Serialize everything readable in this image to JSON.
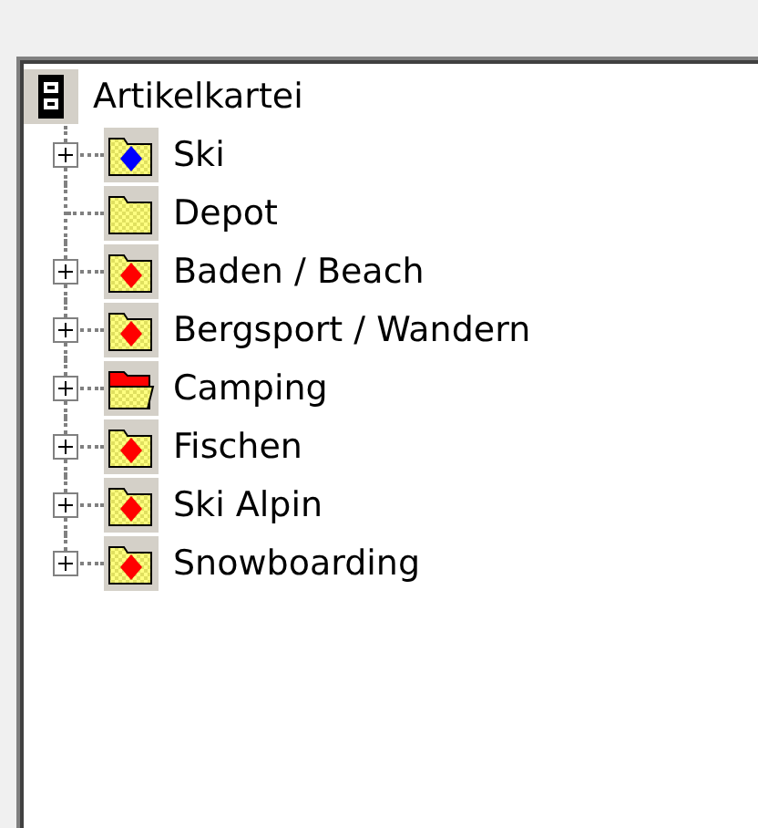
{
  "tree": {
    "root": {
      "label": "Artikelkartei"
    },
    "items": [
      {
        "label": "Ski",
        "expandable": true,
        "expanded": false,
        "icon": {
          "kind": "diamond",
          "color": "#0000ff"
        }
      },
      {
        "label": "Depot",
        "expandable": false,
        "icon": {
          "kind": "plain"
        }
      },
      {
        "label": "Baden / Beach",
        "expandable": true,
        "expanded": false,
        "icon": {
          "kind": "diamond",
          "color": "#ff0000"
        }
      },
      {
        "label": "Bergsport / Wandern",
        "expandable": true,
        "expanded": false,
        "icon": {
          "kind": "diamond",
          "color": "#ff0000"
        }
      },
      {
        "label": "Camping",
        "expandable": true,
        "expanded": false,
        "icon": {
          "kind": "open"
        }
      },
      {
        "label": "Fischen",
        "expandable": true,
        "expanded": false,
        "icon": {
          "kind": "diamond",
          "color": "#ff0000"
        }
      },
      {
        "label": "Ski Alpin",
        "expandable": true,
        "expanded": false,
        "icon": {
          "kind": "diamond",
          "color": "#ff0000"
        }
      },
      {
        "label": "Snowboarding",
        "expandable": true,
        "expanded": false,
        "icon": {
          "kind": "diamond",
          "color": "#ff0000"
        }
      }
    ]
  }
}
